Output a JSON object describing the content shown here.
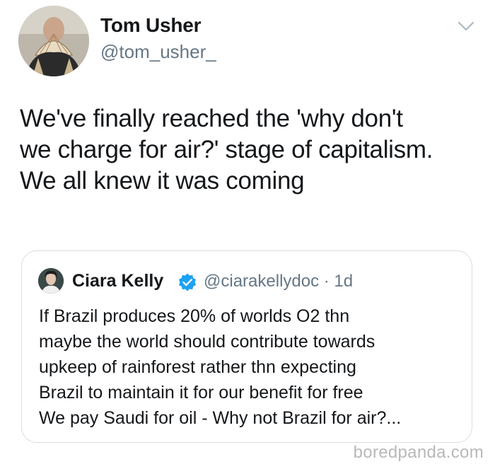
{
  "tweet": {
    "author_name": "Tom Usher",
    "author_handle": "@tom_usher_",
    "avatar_icon": "profile-photo",
    "menu_icon": "chevron-down-icon",
    "lines": [
      "We've finally reached the 'why don't",
      "we charge for air?' stage of capitalism.",
      "We all knew it was coming"
    ]
  },
  "quoted_tweet": {
    "author_name": "Ciara Kelly",
    "verified_icon": "verified-badge-icon",
    "handle_time": "@ciarakellydoc · 1d",
    "lines": [
      "If Brazil produces 20% of worlds O2 thn",
      "maybe the world should contribute towards",
      "upkeep of rainforest rather thn expecting",
      "Brazil to maintain it for our benefit for free",
      "We pay Saudi for oil - Why not Brazil for air?..."
    ]
  },
  "watermark": "boredpanda.com",
  "colors": {
    "text_primary": "#14171a",
    "text_secondary": "#657786",
    "verified_blue": "#1da1f2",
    "border": "#d8dde2",
    "watermark": "#b8b8b8"
  }
}
